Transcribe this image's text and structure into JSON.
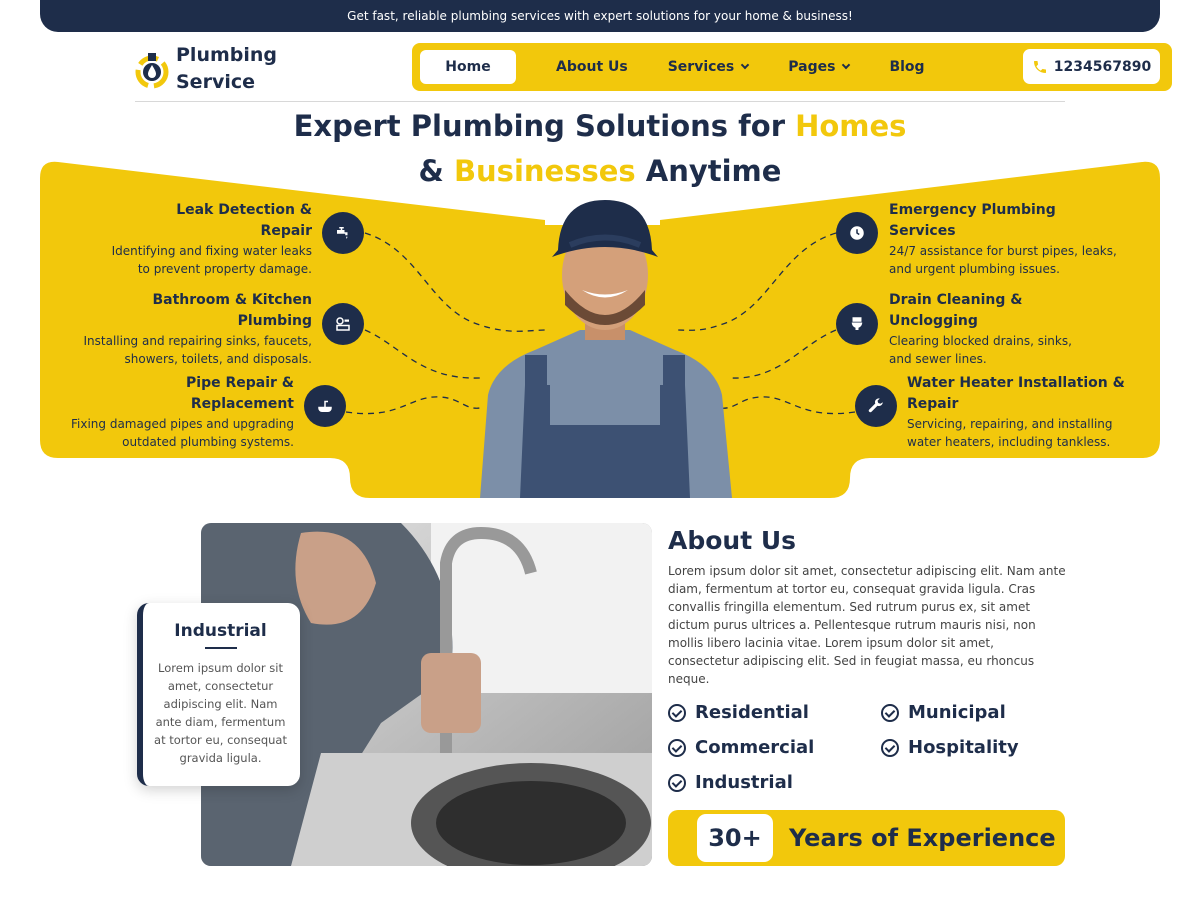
{
  "topbar": {
    "text": "Get fast, reliable plumbing services with expert solutions for your home & business!"
  },
  "logo": {
    "line1": "Plumbing",
    "line2": "Service"
  },
  "nav": {
    "items": [
      {
        "label": "Home"
      },
      {
        "label": "About Us"
      },
      {
        "label": "Services"
      },
      {
        "label": "Pages"
      },
      {
        "label": "Blog"
      }
    ],
    "phone": "1234567890"
  },
  "hero": {
    "title_part1": "Expert Plumbing Solutions for ",
    "title_hl1": "Homes",
    "title_part2": "& ",
    "title_hl2": "Businesses",
    "title_part3": " Anytime"
  },
  "services": [
    {
      "title": "Leak Detection & Repair",
      "desc": "Identifying and fixing water leaks to prevent property damage.",
      "icon": "faucet-icon"
    },
    {
      "title": "Bathroom & Kitchen Plumbing",
      "desc": "Installing and repairing sinks, faucets, showers, toilets, and disposals.",
      "icon": "valve-icon"
    },
    {
      "title": "Pipe Repair & Replacement",
      "desc": "Fixing damaged pipes and upgrading outdated plumbing systems.",
      "icon": "sink-icon"
    },
    {
      "title": "Emergency Plumbing Services",
      "desc": "24/7 assistance for burst pipes, leaks, and urgent plumbing issues.",
      "icon": "clock-icon"
    },
    {
      "title": "Drain Cleaning & Unclogging",
      "desc": "Clearing blocked drains, sinks, and sewer lines.",
      "icon": "toilet-icon"
    },
    {
      "title": "Water Heater Installation & Repair",
      "desc": "Servicing, repairing, and installing water heaters, including tankless.",
      "icon": "wrench-icon"
    }
  ],
  "card": {
    "title": "Industrial",
    "text": "Lorem ipsum dolor sit amet, consectetur adipiscing elit. Nam ante diam, fermentum at tortor eu, consequat gravida ligula."
  },
  "about": {
    "heading": "About Us",
    "paragraph": "Lorem ipsum dolor sit amet, consectetur adipiscing elit. Nam ante diam, fermentum at tortor eu, consequat gravida ligula. Cras convallis fringilla elementum. Sed rutrum purus ex, sit amet dictum purus ultrices a. Pellentesque rutrum mauris nisi, non mollis libero lacinia vitae. Lorem ipsum dolor sit amet, consectetur adipiscing elit. Sed in feugiat massa, eu rhoncus neque.",
    "sectors": [
      "Residential",
      "Municipal",
      "Commercial",
      "Hospitality",
      "Industrial"
    ]
  },
  "experience": {
    "number": "30+",
    "label": "Years of Experience"
  },
  "colors": {
    "navy": "#1e2d4a",
    "yellow": "#f2c80c"
  }
}
